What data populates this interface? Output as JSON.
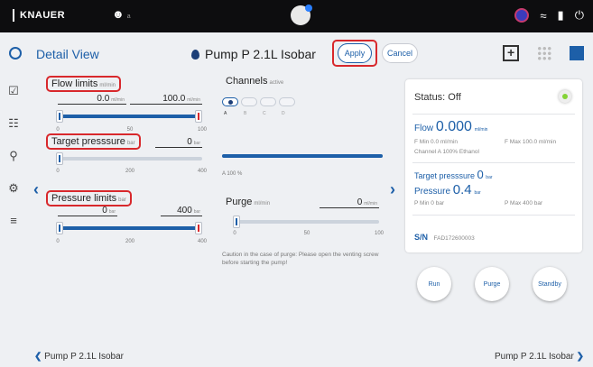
{
  "status_bar": {
    "brand": "KNAUER",
    "user_suffix": "a"
  },
  "header": {
    "detail_view": "Detail View",
    "device_title": "Pump P 2.1L Isobar",
    "apply_label": "Apply",
    "cancel_label": "Cancel"
  },
  "flow_limits": {
    "label": "Flow limits",
    "unit": "ml/min",
    "min_value": "0.0",
    "max_value": "100.0",
    "ticks": [
      "0",
      "50",
      "100"
    ]
  },
  "target_pressure": {
    "label": "Target presssure",
    "unit": "bar",
    "value": "0",
    "ticks": [
      "0",
      "200",
      "400"
    ]
  },
  "pressure_limits": {
    "label": "Pressure limits",
    "unit": "bar",
    "min_value": "0",
    "max_value": "400",
    "ticks": [
      "0",
      "200",
      "400"
    ]
  },
  "channels": {
    "label": "Channels",
    "sub": "active",
    "letters": [
      "A",
      "B",
      "C",
      "D"
    ],
    "bar_text": "A  100 %"
  },
  "purge": {
    "label": "Purge",
    "unit": "ml/min",
    "value": "0",
    "ticks": [
      "0",
      "50",
      "100"
    ],
    "caution": "Caution in the case of purge: Please open the venting screw before starting the pump!"
  },
  "status_card": {
    "status": "Status: Off",
    "flow_label": "Flow",
    "flow_value": "0.000",
    "flow_unit": "ml/min",
    "fmin": "F Min  0.0 ml/min",
    "fmax": "F Max  100.0 ml/min",
    "channel": "Channel A   100%   Ethanol",
    "target_label": "Target presssure",
    "target_value": "0",
    "target_unit": "bar",
    "pressure_label": "Pressure",
    "pressure_value": "0.4",
    "pressure_unit": "bar",
    "pmin": "P Min  0 bar",
    "pmax": "P Max  400 bar",
    "sn_label": "S/N",
    "sn_value": "FAD172600003"
  },
  "actions": {
    "run": "Run",
    "purge": "Purge",
    "standby": "Standby"
  },
  "footer": {
    "prev": "Pump P 2.1L Isobar",
    "next": "Pump P 2.1L Isobar"
  }
}
